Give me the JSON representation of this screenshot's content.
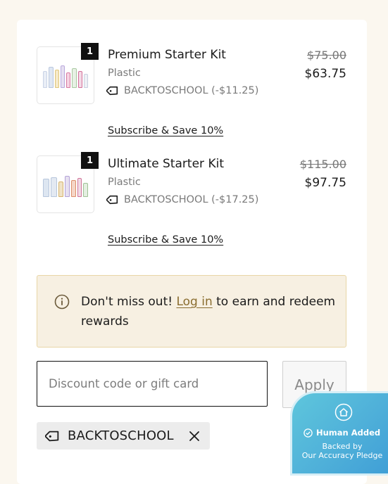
{
  "items": [
    {
      "qty": "1",
      "name": "Premium Starter Kit",
      "variant": "Plastic",
      "discount": "BACKTOSCHOOL (-$11.25)",
      "old_price": "$75.00",
      "price": "$63.75",
      "subscribe": "Subscribe & Save 10%"
    },
    {
      "qty": "1",
      "name": "Ultimate Starter Kit",
      "variant": "Plastic",
      "discount": "BACKTOSCHOOL (-$17.25)",
      "old_price": "$115.00",
      "price": "$97.75",
      "subscribe": "Subscribe & Save 10%"
    }
  ],
  "notice": {
    "pre": "Don't miss out! ",
    "link": "Log in",
    "post": " to earn and redeem rewards"
  },
  "discount_form": {
    "placeholder": "Discount code or gift card",
    "apply_label": "Apply"
  },
  "applied_code": "BACKTOSCHOOL",
  "badge": {
    "line1": "Human Added",
    "line2": "Backed by",
    "line3": "Our Accuracy Pledge"
  },
  "icons": {
    "tag": "tag-icon",
    "info": "info-icon",
    "remove": "close-icon",
    "check": "check-circle-icon",
    "home": "home-icon"
  },
  "colors": {
    "page_bg": "#fbf7ef",
    "notice_bg": "#f7f0e2",
    "notice_border": "#e9d6a6",
    "link": "#8a6d2f",
    "badge": "#4fb0d9"
  }
}
